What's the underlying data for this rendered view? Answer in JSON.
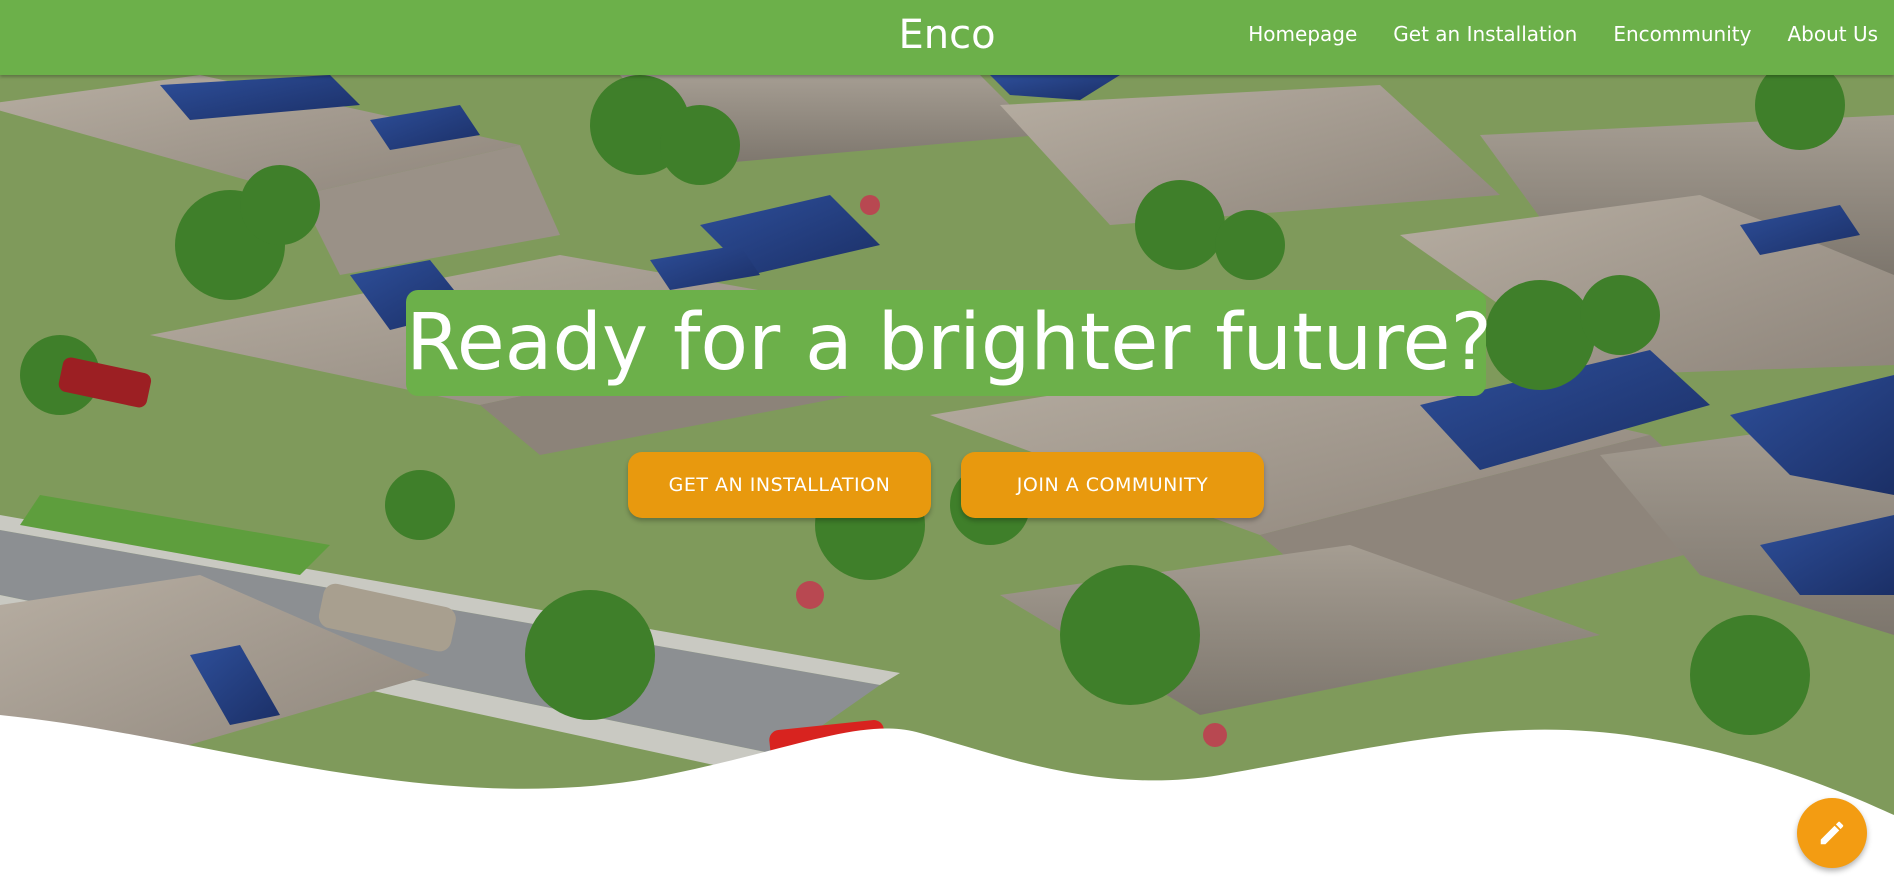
{
  "nav": {
    "brand": "Enco",
    "links": [
      "Homepage",
      "Get an Installation",
      "Encommunity",
      "About Us"
    ]
  },
  "hero": {
    "headline": "Ready for a brighter future?",
    "buttons": {
      "install": "GET AN INSTALLATION",
      "join": "JOIN A COMMUNITY"
    },
    "background": "aerial-view-of-houses-with-solar-panels"
  },
  "fab": {
    "icon": "pencil-icon"
  },
  "colors": {
    "brand_green": "#6cb04a",
    "button_orange": "#e8990e",
    "fab_orange": "#f39c12"
  }
}
